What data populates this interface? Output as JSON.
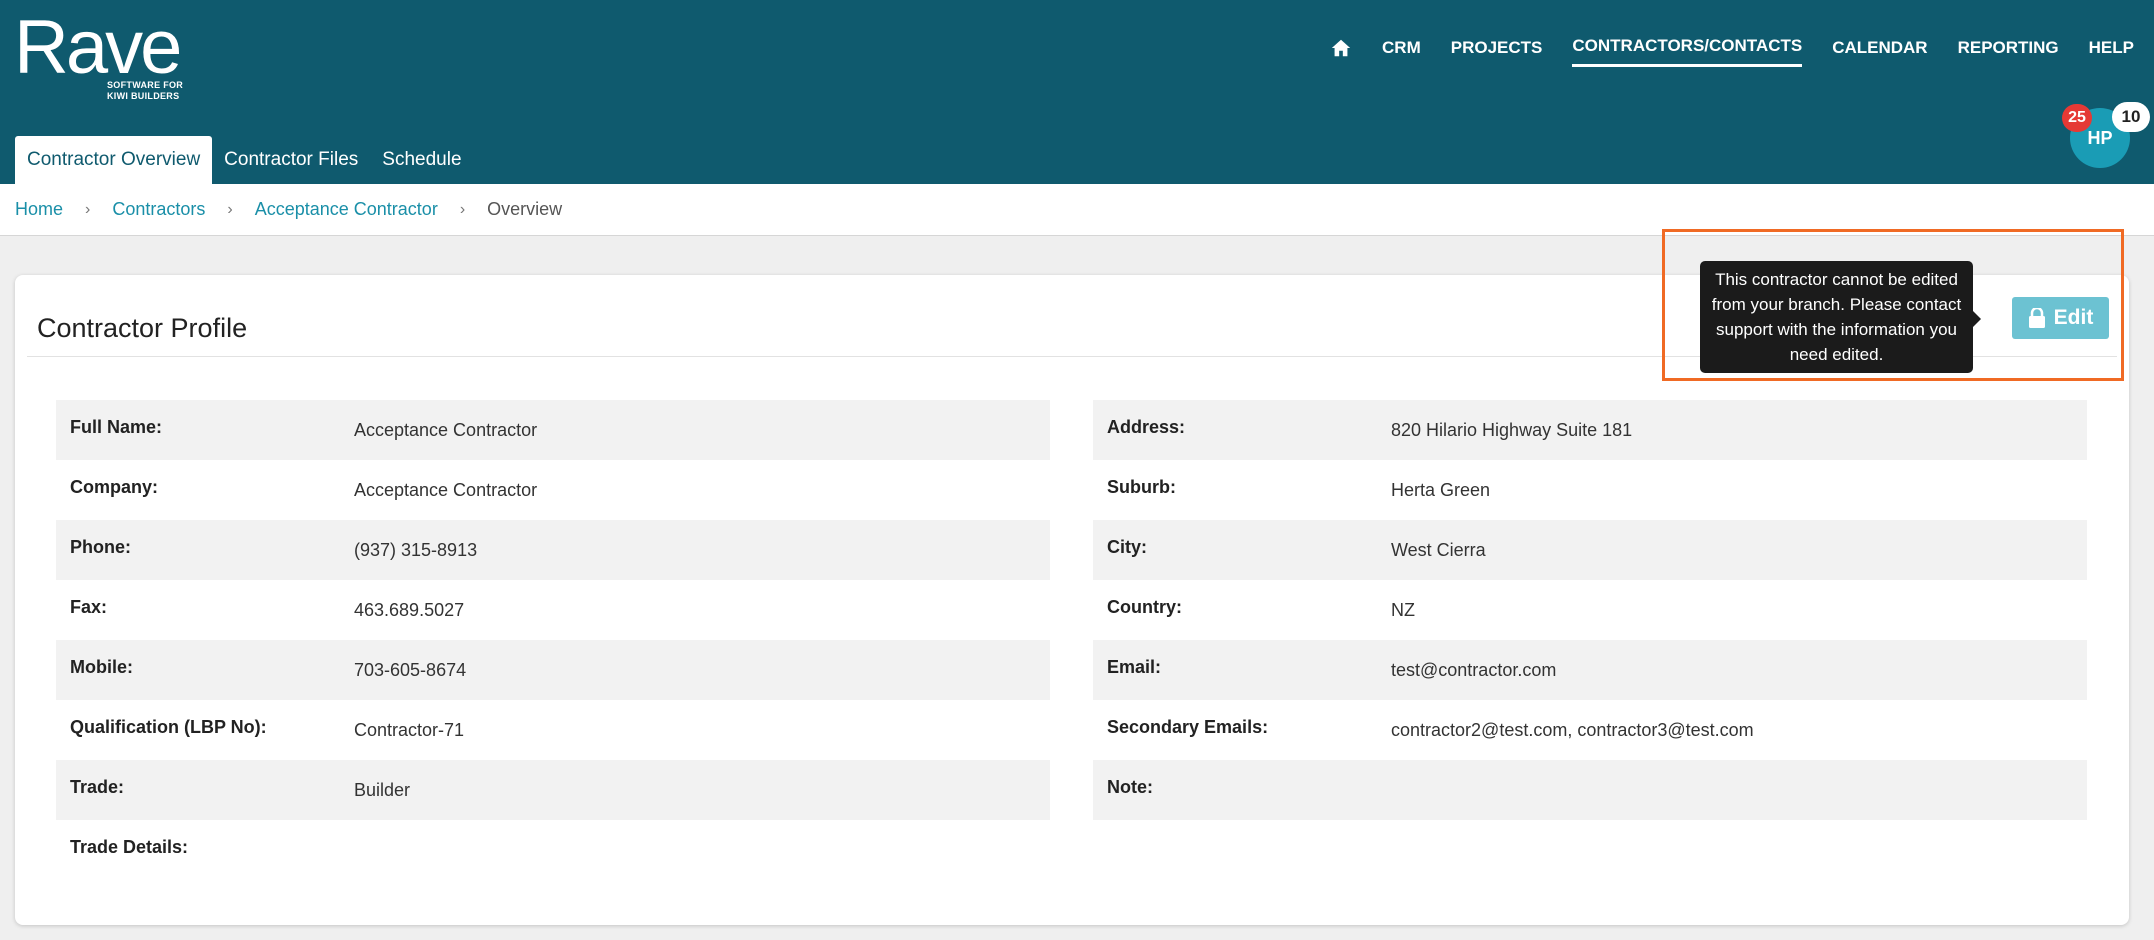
{
  "logo": {
    "word": "Rave",
    "tagline": "SOFTWARE FOR KIWI BUILDERS"
  },
  "nav": {
    "items": [
      "CRM",
      "PROJECTS",
      "CONTRACTORS/CONTACTS",
      "CALENDAR",
      "REPORTING",
      "HELP"
    ],
    "active": "CONTRACTORS/CONTACTS"
  },
  "subtabs": [
    "Contractor Overview",
    "Contractor Files",
    "Schedule"
  ],
  "user": {
    "initials": "HP",
    "badge_red": "25",
    "badge_white": "10"
  },
  "breadcrumb": [
    "Home",
    "Contractors",
    "Acceptance Contractor",
    "Overview"
  ],
  "profile": {
    "title": "Contractor Profile",
    "edit_label": "Edit",
    "tooltip": "This contractor cannot be edited from your branch. Please contact support with the information you need edited.",
    "left": [
      {
        "label": "Full Name:",
        "value": "Acceptance Contractor"
      },
      {
        "label": "Company:",
        "value": "Acceptance Contractor"
      },
      {
        "label": "Phone:",
        "value": "(937) 315-8913"
      },
      {
        "label": "Fax:",
        "value": "463.689.5027"
      },
      {
        "label": "Mobile:",
        "value": "703-605-8674"
      },
      {
        "label": "Qualification (LBP No):",
        "value": "Contractor-71"
      },
      {
        "label": "Trade:",
        "value": "Builder"
      },
      {
        "label": "Trade Details:",
        "value": ""
      }
    ],
    "right": [
      {
        "label": "Address:",
        "value": "820 Hilario Highway Suite 181"
      },
      {
        "label": "Suburb:",
        "value": "Herta Green"
      },
      {
        "label": "City:",
        "value": "West Cierra"
      },
      {
        "label": "Country:",
        "value": "NZ"
      },
      {
        "label": "Email:",
        "value": "test@contractor.com"
      },
      {
        "label": "Secondary Emails:",
        "value": "contractor2@test.com, contractor3@test.com"
      },
      {
        "label": "Note:",
        "value": ""
      }
    ]
  },
  "colors": {
    "header": "#0f5a6e",
    "link": "#1a8fa8",
    "edit": "#6cc2d2",
    "highlight": "#f06a24",
    "avatar": "#1a9cb5"
  },
  "icons": {
    "home": "home-icon",
    "lock": "lock-icon"
  }
}
